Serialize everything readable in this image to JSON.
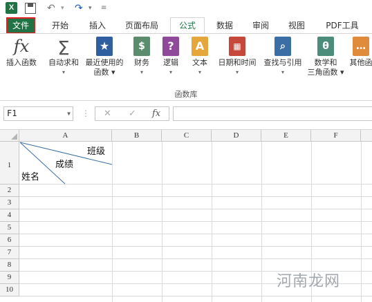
{
  "app": {
    "logo": "X"
  },
  "quick_access": {
    "undo_glyph": "↶",
    "redo_glyph": "↷",
    "dropdown_glyph": "▾",
    "customize_glyph": "≡"
  },
  "tabs": [
    {
      "label": "文件"
    },
    {
      "label": "开始"
    },
    {
      "label": "插入"
    },
    {
      "label": "页面布局"
    },
    {
      "label": "公式"
    },
    {
      "label": "数据"
    },
    {
      "label": "审阅"
    },
    {
      "label": "视图"
    },
    {
      "label": "PDF工具"
    }
  ],
  "ribbon": {
    "group_label": "函数库",
    "buttons": [
      {
        "label": "插入函数",
        "label2": "",
        "icon_text": "fx",
        "icon": "insert-function-icon"
      },
      {
        "label": "自动求和",
        "label2": "▾",
        "icon_text": "Σ",
        "icon": "autosum-icon"
      },
      {
        "label": "最近使用的",
        "label2": "函数 ▾",
        "icon_text": "★",
        "icon": "recent-star-icon"
      },
      {
        "label": "财务",
        "label2": "▾",
        "icon_text": "$",
        "icon": "financial-icon"
      },
      {
        "label": "逻辑",
        "label2": "▾",
        "icon_text": "?",
        "icon": "logical-icon"
      },
      {
        "label": "文本",
        "label2": "▾",
        "icon_text": "A",
        "icon": "text-icon"
      },
      {
        "label": "日期和时间",
        "label2": "▾",
        "icon_text": "▦",
        "icon": "calendar-icon"
      },
      {
        "label": "查找与引用",
        "label2": "▾",
        "icon_text": "⌕",
        "icon": "lookup-icon"
      },
      {
        "label": "数学和",
        "label2": "三角函数 ▾",
        "icon_text": "θ",
        "icon": "math-trig-icon"
      },
      {
        "label": "其他函",
        "label2": "",
        "icon_text": "…",
        "icon": "more-functions-icon"
      }
    ]
  },
  "formula_bar": {
    "name_box": "F1",
    "cancel_glyph": "✕",
    "enter_glyph": "✓",
    "fx_glyph": "fx",
    "formula": ""
  },
  "sheet": {
    "columns": [
      "A",
      "B",
      "C",
      "D",
      "E",
      "F"
    ],
    "rows": [
      "1",
      "2",
      "3",
      "4",
      "5",
      "6",
      "7",
      "8",
      "9",
      "10"
    ],
    "cell_a1": {
      "top_right": "班级",
      "middle": "成绩",
      "bottom_left": "姓名"
    }
  },
  "watermark": "河南龙网"
}
